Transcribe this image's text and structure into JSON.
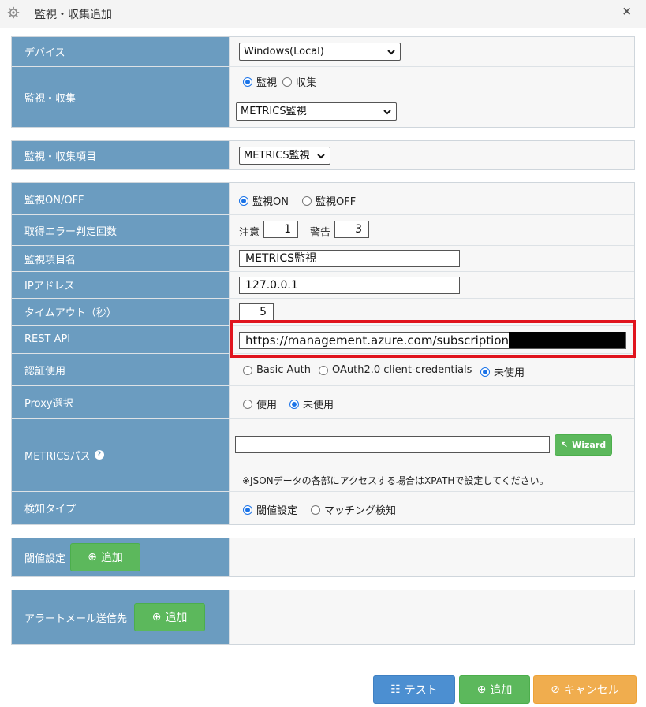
{
  "window": {
    "title": "監視・収集追加",
    "close": "×",
    "settings_icon": "gear-icon"
  },
  "device": {
    "label": "デバイス",
    "selected": "Windows(Local)"
  },
  "monitor_collect": {
    "label": "監視・収集",
    "options": [
      "監視",
      "収集"
    ],
    "selected_index": 0,
    "type_selected": "METRICS監視"
  },
  "item": {
    "label": "監視・収集項目",
    "selected": "METRICS監視"
  },
  "monitor_onoff": {
    "label": "監視ON/OFF",
    "options": [
      "監視ON",
      "監視OFF"
    ],
    "selected_index": 0
  },
  "error_count": {
    "label": "取得エラー判定回数",
    "caution_label": "注意",
    "caution_value": "1",
    "warning_label": "警告",
    "warning_value": "3"
  },
  "item_name": {
    "label": "監視項目名",
    "value": "METRICS監視"
  },
  "ip": {
    "label": "IPアドレス",
    "value": "127.0.0.1"
  },
  "timeout": {
    "label": "タイムアウト（秒）",
    "value": "5"
  },
  "rest_api": {
    "label": "REST API",
    "value": "https://management.azure.com/subscriptions/"
  },
  "auth": {
    "label": "認証使用",
    "options": [
      "Basic Auth",
      "OAuth2.0 client-credentials",
      "未使用"
    ],
    "selected_index": 2
  },
  "proxy": {
    "label": "Proxy選択",
    "options": [
      "使用",
      "未使用"
    ],
    "selected_index": 1
  },
  "metrics_path": {
    "label": "METRICSパス",
    "help": "?",
    "value": "",
    "wizard_label": "Wizard",
    "note": "※JSONデータの各部にアクセスする場合はXPATHで設定してください。"
  },
  "detect_type": {
    "label": "検知タイプ",
    "options": [
      "閾値設定",
      "マッチング検知"
    ],
    "selected_index": 0
  },
  "threshold": {
    "label": "閾値設定",
    "add_label": "追加"
  },
  "alert_mail": {
    "label": "アラートメール送信先",
    "add_label": "追加"
  },
  "footer": {
    "test_label": "テスト",
    "add_label": "追加",
    "cancel_label": "キャンセル"
  },
  "colors": {
    "label_bg": "#6b9cc0",
    "green": "#5cb85c",
    "blue": "#4c8fd1",
    "orange": "#f0ad4e",
    "highlight": "#e0141e"
  }
}
